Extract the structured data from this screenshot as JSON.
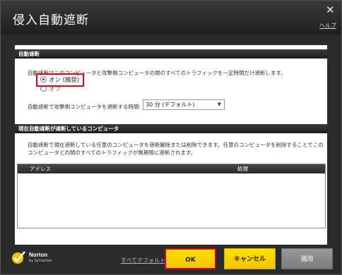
{
  "window": {
    "title": "侵入自動遮断",
    "help_label": "ヘルプ"
  },
  "auto_block": {
    "header": "自動遮断",
    "description": "自動遮断はこのコンピュータと攻撃側コンピュータの間のすべてのトラフィックを一定時間だけ遮断します。",
    "options": [
      {
        "label": "オン (推奨)",
        "selected": true
      },
      {
        "label": "オフ",
        "selected": false
      }
    ],
    "duration_label": "自動遮断で攻撃側コンピュータを遮断する時間:",
    "duration_value": "30 分 (デフォルト)"
  },
  "blocked": {
    "header": "現在自動遮断が遮断しているコンピュータ",
    "description_line1": "自動遮断で現在遮断している任意のコンピュータを遮断解除または削除できます。任意のコンピュータを削除することでこの",
    "description_line2": "コンピュータとの間のすべてのトラフィックが無期限に遮断されます。",
    "columns": [
      "アドレス",
      "処理"
    ],
    "rows": []
  },
  "footer": {
    "brand": "Norton",
    "brand_sub": "by Symantec",
    "defaults_link": "すべてデフォルト",
    "ok_label": "OK",
    "cancel_label": "キャンセル",
    "apply_label": "適用"
  },
  "colors": {
    "accent_yellow": "#ffd700",
    "highlight_red": "#e60012",
    "dark_chrome": "#2b2b2b"
  }
}
